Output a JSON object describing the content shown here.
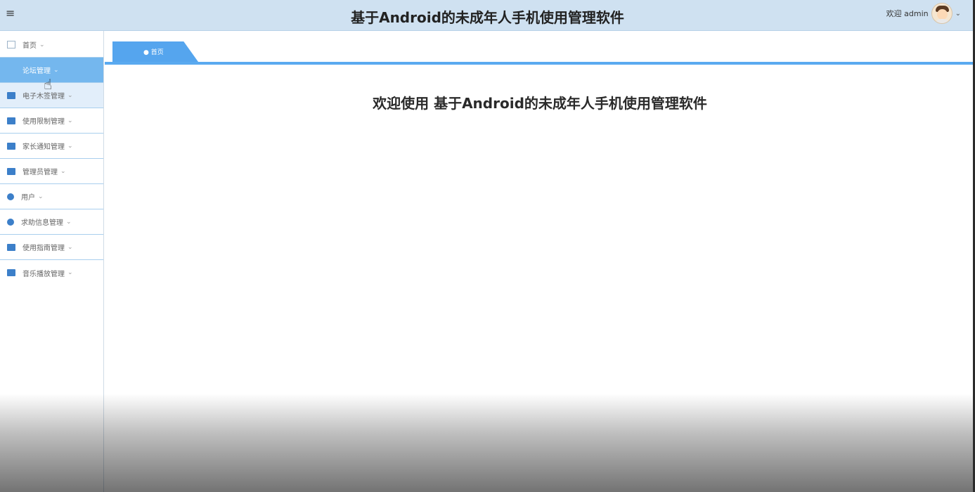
{
  "header": {
    "menu_icon": "hamburger-icon",
    "title": "基于Android的未成年人手机使用管理软件",
    "welcome_user": "欢迎 admin",
    "avatar_icon": "user-avatar",
    "dropdown_icon": "chevron-down-icon"
  },
  "sidebar": {
    "items": [
      {
        "label": "首页",
        "icon": "home-icon"
      },
      {
        "label": "论坛管理",
        "icon": "none"
      },
      {
        "label": "电子木签管理",
        "icon": "image-icon"
      },
      {
        "label": "使用限制管理",
        "icon": "table-icon"
      },
      {
        "label": "家长通知管理",
        "icon": "columns-icon"
      },
      {
        "label": "管理员管理",
        "icon": "grid-icon"
      },
      {
        "label": "用户",
        "icon": "user-icon"
      },
      {
        "label": "求助信息管理",
        "icon": "settings-icon"
      },
      {
        "label": "使用指南管理",
        "icon": "printer-icon"
      },
      {
        "label": "音乐播放管理",
        "icon": "card-icon"
      }
    ]
  },
  "tabs": {
    "home_label": "● 首页"
  },
  "main": {
    "welcome_text": "欢迎使用 基于Android的未成年人手机使用管理软件"
  },
  "colors": {
    "header_bg": "#cfe1f1",
    "accent": "#55a5ee",
    "active_item": "#74b7ee"
  }
}
